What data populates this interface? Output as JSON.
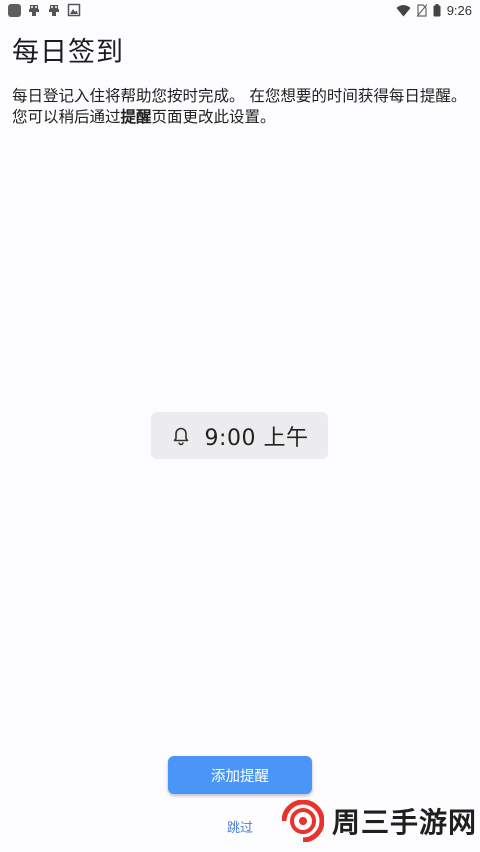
{
  "status_bar": {
    "time": "9:26",
    "icons": [
      "notification-square-icon",
      "app-icon",
      "app-icon",
      "image-icon",
      "wifi-icon",
      "no-sim-icon",
      "battery-icon"
    ]
  },
  "header": {
    "title": "每日签到"
  },
  "description": {
    "part1": "每日登记入住将帮助您按时完成。 在您想要的时间获得每日提醒。 您可以稍后通过",
    "bold": "提醒",
    "part2": "页面更改此设置。"
  },
  "reminder": {
    "icon": "bell-icon",
    "time": "9:00 上午"
  },
  "actions": {
    "add_label": "添加提醒",
    "skip_label": "跳过"
  },
  "watermark": {
    "text": "周三手游网",
    "colors": {
      "red": "#e8322b",
      "dark": "#1f1f1f"
    }
  },
  "colors": {
    "accent": "#4a95f5",
    "link": "#4a7fd0",
    "chip": "#ececee",
    "background": "#fdfcfe"
  }
}
